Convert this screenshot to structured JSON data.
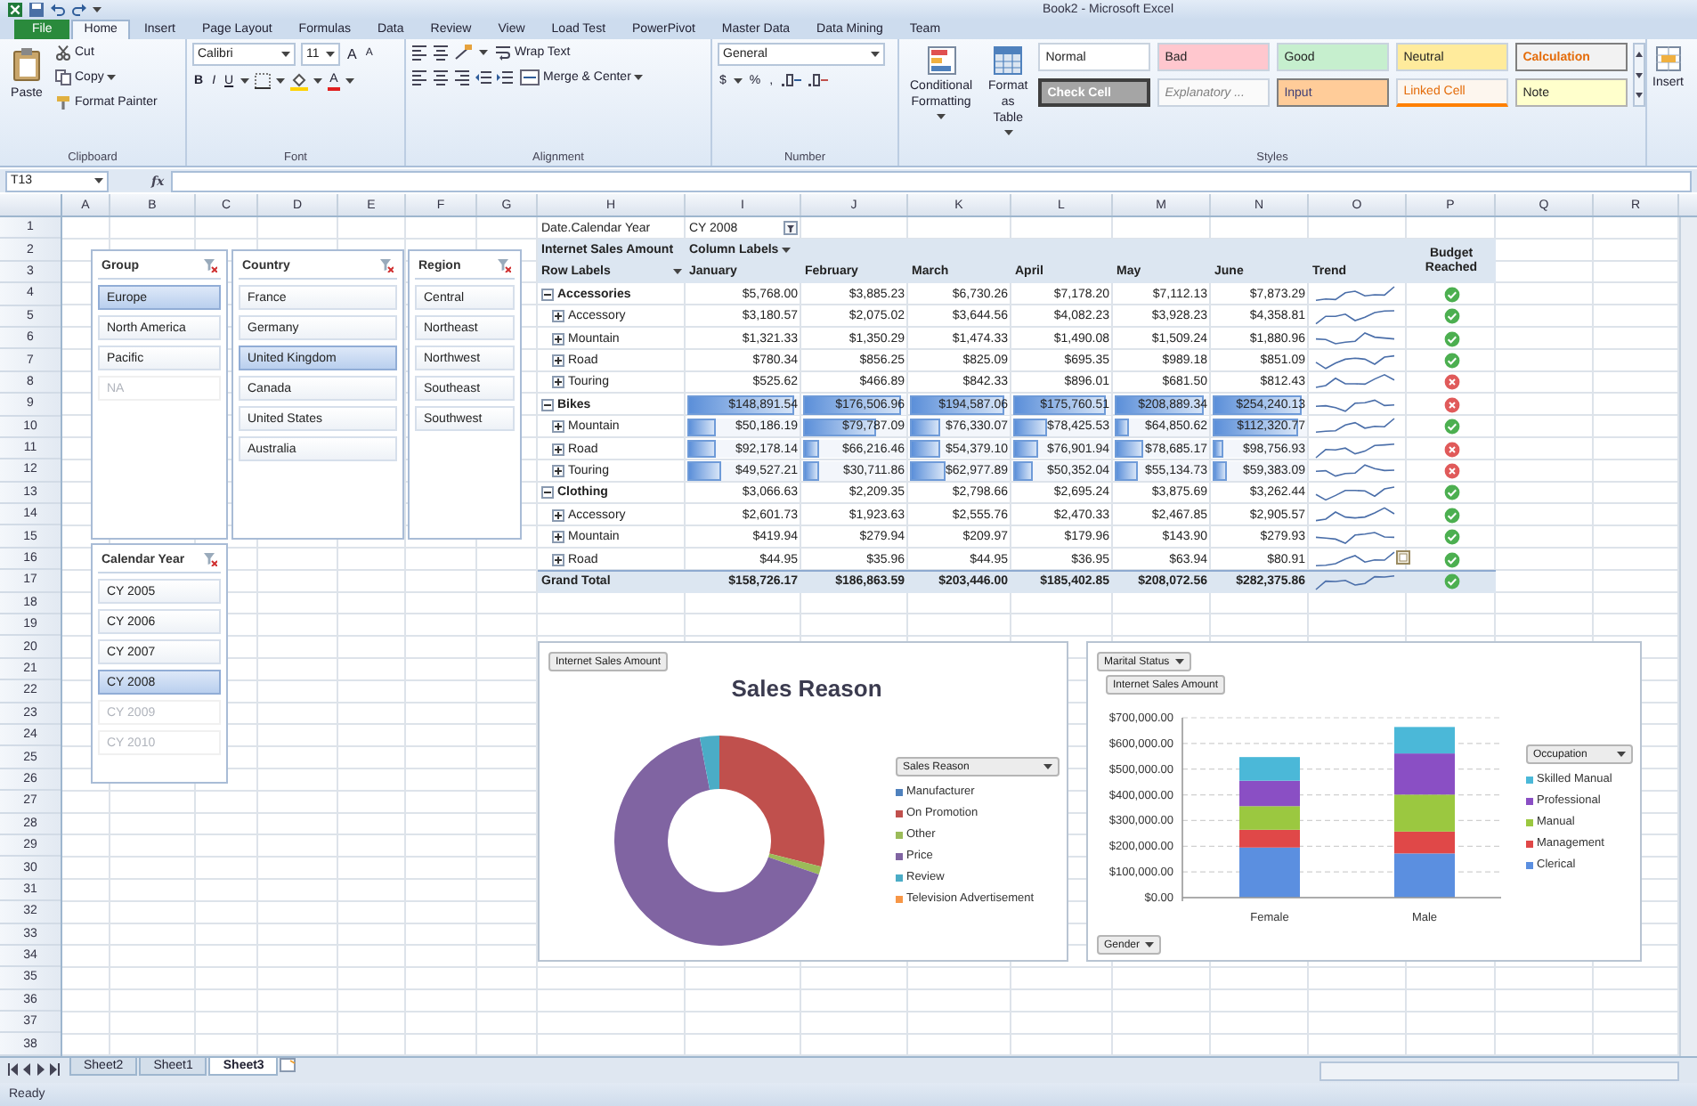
{
  "window": {
    "title": "Book2 - Microsoft Excel"
  },
  "ribbon_tabs": [
    {
      "label": "File",
      "kind": "file",
      "selected": false
    },
    {
      "label": "Home",
      "kind": "tab",
      "selected": true
    },
    {
      "label": "Insert",
      "kind": "tab",
      "selected": false
    },
    {
      "label": "Page Layout",
      "kind": "tab",
      "selected": false
    },
    {
      "label": "Formulas",
      "kind": "tab",
      "selected": false
    },
    {
      "label": "Data",
      "kind": "tab",
      "selected": false
    },
    {
      "label": "Review",
      "kind": "tab",
      "selected": false
    },
    {
      "label": "View",
      "kind": "tab",
      "selected": false
    },
    {
      "label": "Load Test",
      "kind": "tab",
      "selected": false
    },
    {
      "label": "PowerPivot",
      "kind": "tab",
      "selected": false
    },
    {
      "label": "Master Data",
      "kind": "tab",
      "selected": false
    },
    {
      "label": "Data Mining",
      "kind": "tab",
      "selected": false
    },
    {
      "label": "Team",
      "kind": "tab",
      "selected": false
    }
  ],
  "ribbon": {
    "clipboard": {
      "paste": "Paste",
      "cut": "Cut",
      "copy": "Copy",
      "format_painter": "Format Painter",
      "label": "Clipboard"
    },
    "font": {
      "name": "Calibri",
      "size": "11",
      "grow": "A",
      "shrink": "A",
      "bold": "B",
      "italic": "I",
      "underline": "U",
      "font_color": "A",
      "label": "Font"
    },
    "alignment": {
      "wrap_text": "Wrap Text",
      "merge": "Merge & Center",
      "label": "Alignment"
    },
    "number": {
      "format": "General",
      "currency": "$",
      "percent": "%",
      "comma": ",",
      "label": "Number"
    },
    "styles": {
      "conditional": "Conditional Formatting",
      "format_table": "Format as Table",
      "label": "Styles",
      "cell_styles": [
        {
          "label": "Normal",
          "color": "#ffffff"
        },
        {
          "label": "Bad",
          "color": "#ffc7ce"
        },
        {
          "label": "Good",
          "color": "#c6efce"
        },
        {
          "label": "Neutral",
          "color": "#ffeb9c"
        },
        {
          "label": "Calculation",
          "color": "#f2f2f2"
        },
        {
          "label": "Check Cell",
          "color": "#a5a5a5"
        },
        {
          "label": "Explanatory ...",
          "color": "#fafafa"
        },
        {
          "label": "Input",
          "color": "#ffcc99"
        },
        {
          "label": "Linked Cell",
          "color": "#fdf6ee"
        },
        {
          "label": "Note",
          "color": "#ffffcc"
        }
      ]
    },
    "cells": {
      "insert": "Insert"
    }
  },
  "formula_bar": {
    "name_box": "T13",
    "fx": "fx"
  },
  "columns": [
    "A",
    "B",
    "C",
    "D",
    "E",
    "F",
    "G",
    "H",
    "I",
    "J",
    "K",
    "L",
    "M",
    "N",
    "O",
    "P",
    "Q",
    "R"
  ],
  "row_numbers": [
    "1",
    "2",
    "3",
    "4",
    "5",
    "6",
    "7",
    "8",
    "9",
    "10",
    "11",
    "12",
    "13",
    "14",
    "15",
    "16",
    "17",
    "18",
    "19",
    "20",
    "21",
    "22",
    "23",
    "24",
    "25",
    "26",
    "27",
    "28",
    "29",
    "30",
    "31",
    "32",
    "33",
    "34",
    "35",
    "36",
    "37",
    "38"
  ],
  "slicers": [
    {
      "title": "Group",
      "items": [
        {
          "label": "Europe",
          "selected": true,
          "disabled": false
        },
        {
          "label": "North America",
          "selected": false,
          "disabled": false
        },
        {
          "label": "Pacific",
          "selected": false,
          "disabled": false
        },
        {
          "label": "NA",
          "selected": false,
          "disabled": true
        }
      ]
    },
    {
      "title": "Country",
      "items": [
        {
          "label": "France",
          "selected": false,
          "disabled": false
        },
        {
          "label": "Germany",
          "selected": false,
          "disabled": false
        },
        {
          "label": "United Kingdom",
          "selected": true,
          "disabled": false
        },
        {
          "label": "Canada",
          "selected": false,
          "disabled": false
        },
        {
          "label": "United States",
          "selected": false,
          "disabled": false
        },
        {
          "label": "Australia",
          "selected": false,
          "disabled": false
        }
      ]
    },
    {
      "title": "Region",
      "items": [
        {
          "label": "Central",
          "selected": false,
          "disabled": false
        },
        {
          "label": "Northeast",
          "selected": false,
          "disabled": false
        },
        {
          "label": "Northwest",
          "selected": false,
          "disabled": false
        },
        {
          "label": "Southeast",
          "selected": false,
          "disabled": false
        },
        {
          "label": "Southwest",
          "selected": false,
          "disabled": false
        }
      ]
    },
    {
      "title": "Calendar Year",
      "items": [
        {
          "label": "CY 2005",
          "selected": false,
          "disabled": false
        },
        {
          "label": "CY 2006",
          "selected": false,
          "disabled": false
        },
        {
          "label": "CY 2007",
          "selected": false,
          "disabled": false
        },
        {
          "label": "CY 2008",
          "selected": true,
          "disabled": false
        },
        {
          "label": "CY 2009",
          "selected": false,
          "disabled": true
        },
        {
          "label": "CY 2010",
          "selected": false,
          "disabled": true
        }
      ]
    }
  ],
  "pivot": {
    "filter_field": "Date.Calendar Year",
    "filter_value": "CY 2008",
    "values_label": "Internet Sales Amount",
    "column_labels": "Column Labels",
    "row_labels": "Row Labels",
    "months": [
      "January",
      "February",
      "March",
      "April",
      "May",
      "June"
    ],
    "trend": "Trend",
    "budget": "Budget Reached",
    "categories": [
      {
        "label": "Accessories",
        "expanded": true,
        "reached": true,
        "cells": [
          "$5,768.00",
          "$3,885.23",
          "$6,730.26",
          "$7,178.20",
          "$7,112.13",
          "$7,873.29"
        ],
        "children": [
          {
            "label": "Accessory",
            "expanded": false,
            "reached": true,
            "cells": [
              "$3,180.57",
              "$2,075.02",
              "$3,644.56",
              "$4,082.23",
              "$3,928.23",
              "$4,358.81"
            ]
          },
          {
            "label": "Mountain",
            "expanded": false,
            "reached": true,
            "cells": [
              "$1,321.33",
              "$1,350.29",
              "$1,474.33",
              "$1,490.08",
              "$1,509.24",
              "$1,880.96"
            ]
          },
          {
            "label": "Road",
            "expanded": false,
            "reached": true,
            "cells": [
              "$780.34",
              "$856.25",
              "$825.09",
              "$695.35",
              "$989.18",
              "$851.09"
            ]
          },
          {
            "label": "Touring",
            "expanded": false,
            "reached": false,
            "cells": [
              "$525.62",
              "$466.89",
              "$842.33",
              "$896.01",
              "$681.50",
              "$812.43"
            ]
          }
        ]
      },
      {
        "label": "Bikes",
        "expanded": true,
        "reached": false,
        "cells": [
          {
            "text": "$148,891.54",
            "level": 0.95
          },
          {
            "text": "$176,506.96",
            "level": 0.95
          },
          {
            "text": "$194,587.06",
            "level": 0.95
          },
          {
            "text": "$175,760.51",
            "level": 0.95
          },
          {
            "text": "$208,889.34",
            "level": 0.95
          },
          {
            "text": "$254,240.13",
            "level": 0.95
          }
        ],
        "children": [
          {
            "label": "Mountain",
            "expanded": false,
            "reached": true,
            "cells": [
              {
                "text": "$50,186.19",
                "level": 0.25
              },
              {
                "text": "$79,787.09",
                "level": 0.7
              },
              {
                "text": "$76,330.07",
                "level": 0.3
              },
              {
                "text": "$78,425.53",
                "level": 0.35
              },
              {
                "text": "$64,850.62",
                "level": 0.15
              },
              {
                "text": "$112,320.77",
                "level": 0.9
              }
            ]
          },
          {
            "label": "Road",
            "expanded": false,
            "reached": false,
            "cells": [
              {
                "text": "$92,178.14",
                "level": 0.25
              },
              {
                "text": "$66,216.46",
                "level": 0.15
              },
              {
                "text": "$54,379.10",
                "level": 0.3
              },
              {
                "text": "$76,901.94",
                "level": 0.25
              },
              {
                "text": "$78,685.17",
                "level": 0.3
              },
              {
                "text": "$98,756.93",
                "level": 0.12
              }
            ]
          },
          {
            "label": "Touring",
            "expanded": false,
            "reached": false,
            "cells": [
              {
                "text": "$49,527.21",
                "level": 0.3
              },
              {
                "text": "$30,711.86",
                "level": 0.15
              },
              {
                "text": "$62,977.89",
                "level": 0.35
              },
              {
                "text": "$50,352.04",
                "level": 0.2
              },
              {
                "text": "$55,134.73",
                "level": 0.25
              },
              {
                "text": "$59,383.09",
                "level": 0.15
              }
            ]
          }
        ]
      },
      {
        "label": "Clothing",
        "expanded": true,
        "reached": true,
        "cells": [
          "$3,066.63",
          "$2,209.35",
          "$2,798.66",
          "$2,695.24",
          "$3,875.69",
          "$3,262.44"
        ],
        "children": [
          {
            "label": "Accessory",
            "expanded": false,
            "reached": true,
            "cells": [
              "$2,601.73",
              "$1,923.63",
              "$2,555.76",
              "$2,470.33",
              "$2,467.85",
              "$2,905.57"
            ]
          },
          {
            "label": "Mountain",
            "expanded": false,
            "reached": true,
            "cells": [
              "$419.94",
              "$279.94",
              "$209.97",
              "$179.96",
              "$143.90",
              "$279.93"
            ]
          },
          {
            "label": "Road",
            "expanded": false,
            "reached": true,
            "cells": [
              "$44.95",
              "$35.96",
              "$44.95",
              "$36.95",
              "$63.94",
              "$80.91"
            ]
          }
        ]
      }
    ],
    "grand_total": {
      "label": "Grand Total",
      "reached": true,
      "cells": [
        "$158,726.17",
        "$186,863.59",
        "$203,446.00",
        "$185,402.85",
        "$208,072.56",
        "$282,375.86"
      ]
    }
  },
  "sales_reason_chart": {
    "value_button": "Internet Sales Amount",
    "title": "Sales Reason",
    "legend_button": "Sales Reason",
    "legend": [
      {
        "label": "Manufacturer",
        "color": "#4f81bd"
      },
      {
        "label": "On Promotion",
        "color": "#c0504d"
      },
      {
        "label": "Other",
        "color": "#9bbb59"
      },
      {
        "label": "Price",
        "color": "#8064a2"
      },
      {
        "label": "Review",
        "color": "#4bacc6"
      },
      {
        "label": "Television  Advertisement",
        "color": "#f79646"
      }
    ]
  },
  "gender_chart": {
    "filter_button": "Marital Status",
    "value_button": "Internet Sales Amount",
    "legend_button": "Occupation",
    "axis_button": "Gender",
    "chart_data": {
      "type": "bar",
      "stacked": true,
      "grid": true,
      "categories": [
        "Female",
        "Male"
      ],
      "ylim": [
        0,
        700000
      ],
      "yticks": [
        {
          "value": 0,
          "label": "$0.00"
        },
        {
          "value": 100000,
          "label": "$100,000.00"
        },
        {
          "value": 200000,
          "label": "$200,000.00"
        },
        {
          "value": 300000,
          "label": "$300,000.00"
        },
        {
          "value": 400000,
          "label": "$400,000.00"
        },
        {
          "value": 500000,
          "label": "$500,000.00"
        },
        {
          "value": 600000,
          "label": "$600,000.00"
        },
        {
          "value": 700000,
          "label": "$700,000.00"
        }
      ],
      "series": [
        {
          "name": "Clerical",
          "color": "#5b8fe0",
          "values": [
            195000,
            172000
          ]
        },
        {
          "name": "Management",
          "color": "#e04848",
          "values": [
            69000,
            85000
          ]
        },
        {
          "name": "Manual",
          "color": "#9bc840",
          "values": [
            92000,
            144000
          ]
        },
        {
          "name": "Professional",
          "color": "#8a4fc4",
          "values": [
            99000,
            160000
          ]
        },
        {
          "name": "Skilled Manual",
          "color": "#4bb8d8",
          "values": [
            92000,
            103000
          ]
        }
      ]
    }
  },
  "sheet_tabs": [
    {
      "label": "Sheet2",
      "selected": false
    },
    {
      "label": "Sheet1",
      "selected": false
    },
    {
      "label": "Sheet3",
      "selected": true
    }
  ],
  "status": "Ready"
}
